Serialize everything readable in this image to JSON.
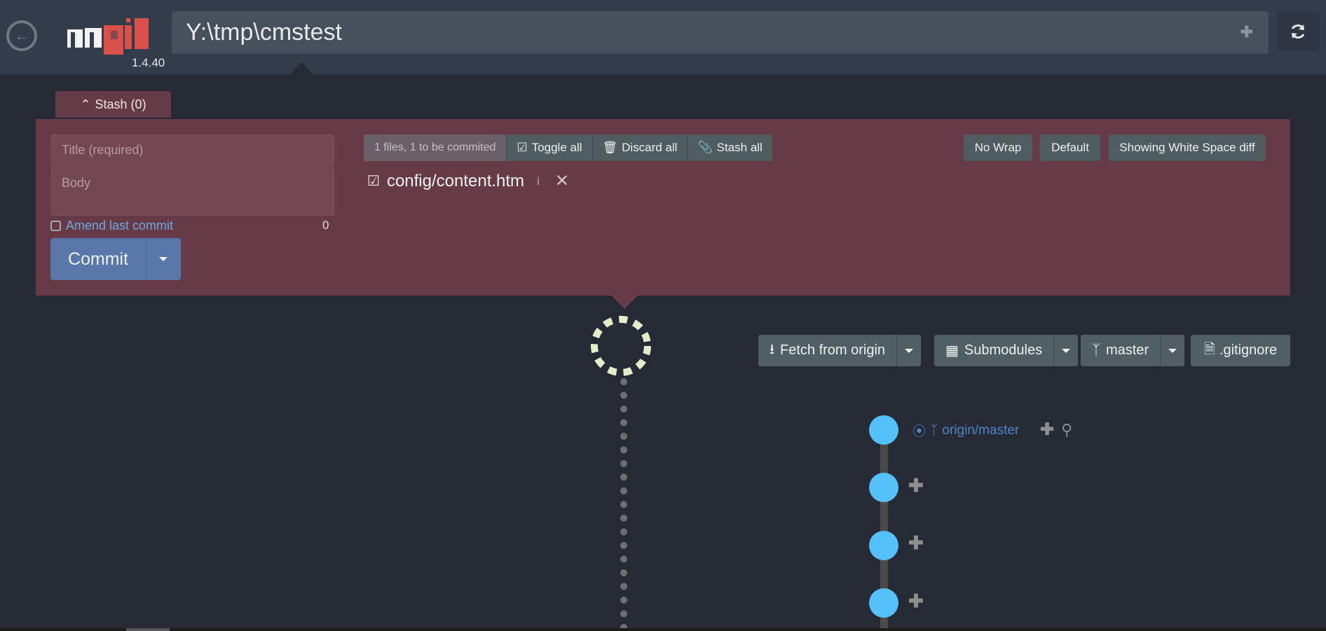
{
  "app": {
    "version": "1.4.40",
    "repo_path": "Y:\\tmp\\cmstest"
  },
  "stash": {
    "label": "Stash (0)"
  },
  "commit_form": {
    "title_placeholder": "Title (required)",
    "body_placeholder": "Body",
    "amend_label": "Amend last commit",
    "char_count": "0",
    "commit_label": "Commit"
  },
  "file_toolbar": {
    "count_label": "1 files, 1 to be commited",
    "toggle_all": "Toggle all",
    "discard_all": "Discard all",
    "stash_all": "Stash all"
  },
  "diff_options": {
    "wrap": "No Wrap",
    "mode": "Default",
    "whitespace": "Showing White Space diff"
  },
  "files": [
    {
      "name": "config/content.htm",
      "info": "i",
      "checked": true
    }
  ],
  "actions": {
    "fetch": "Fetch from origin",
    "submodules": "Submodules",
    "branch": "master",
    "gitignore": ".gitignore"
  },
  "graph": {
    "ref_label": "origin/master",
    "node_color": "#54c1fa",
    "node_count": 4
  },
  "colors": {
    "accent_blue": "#5977a8",
    "panel": "#663a46",
    "topbar": "#323c4a",
    "spinner": "#e5ecc9"
  }
}
